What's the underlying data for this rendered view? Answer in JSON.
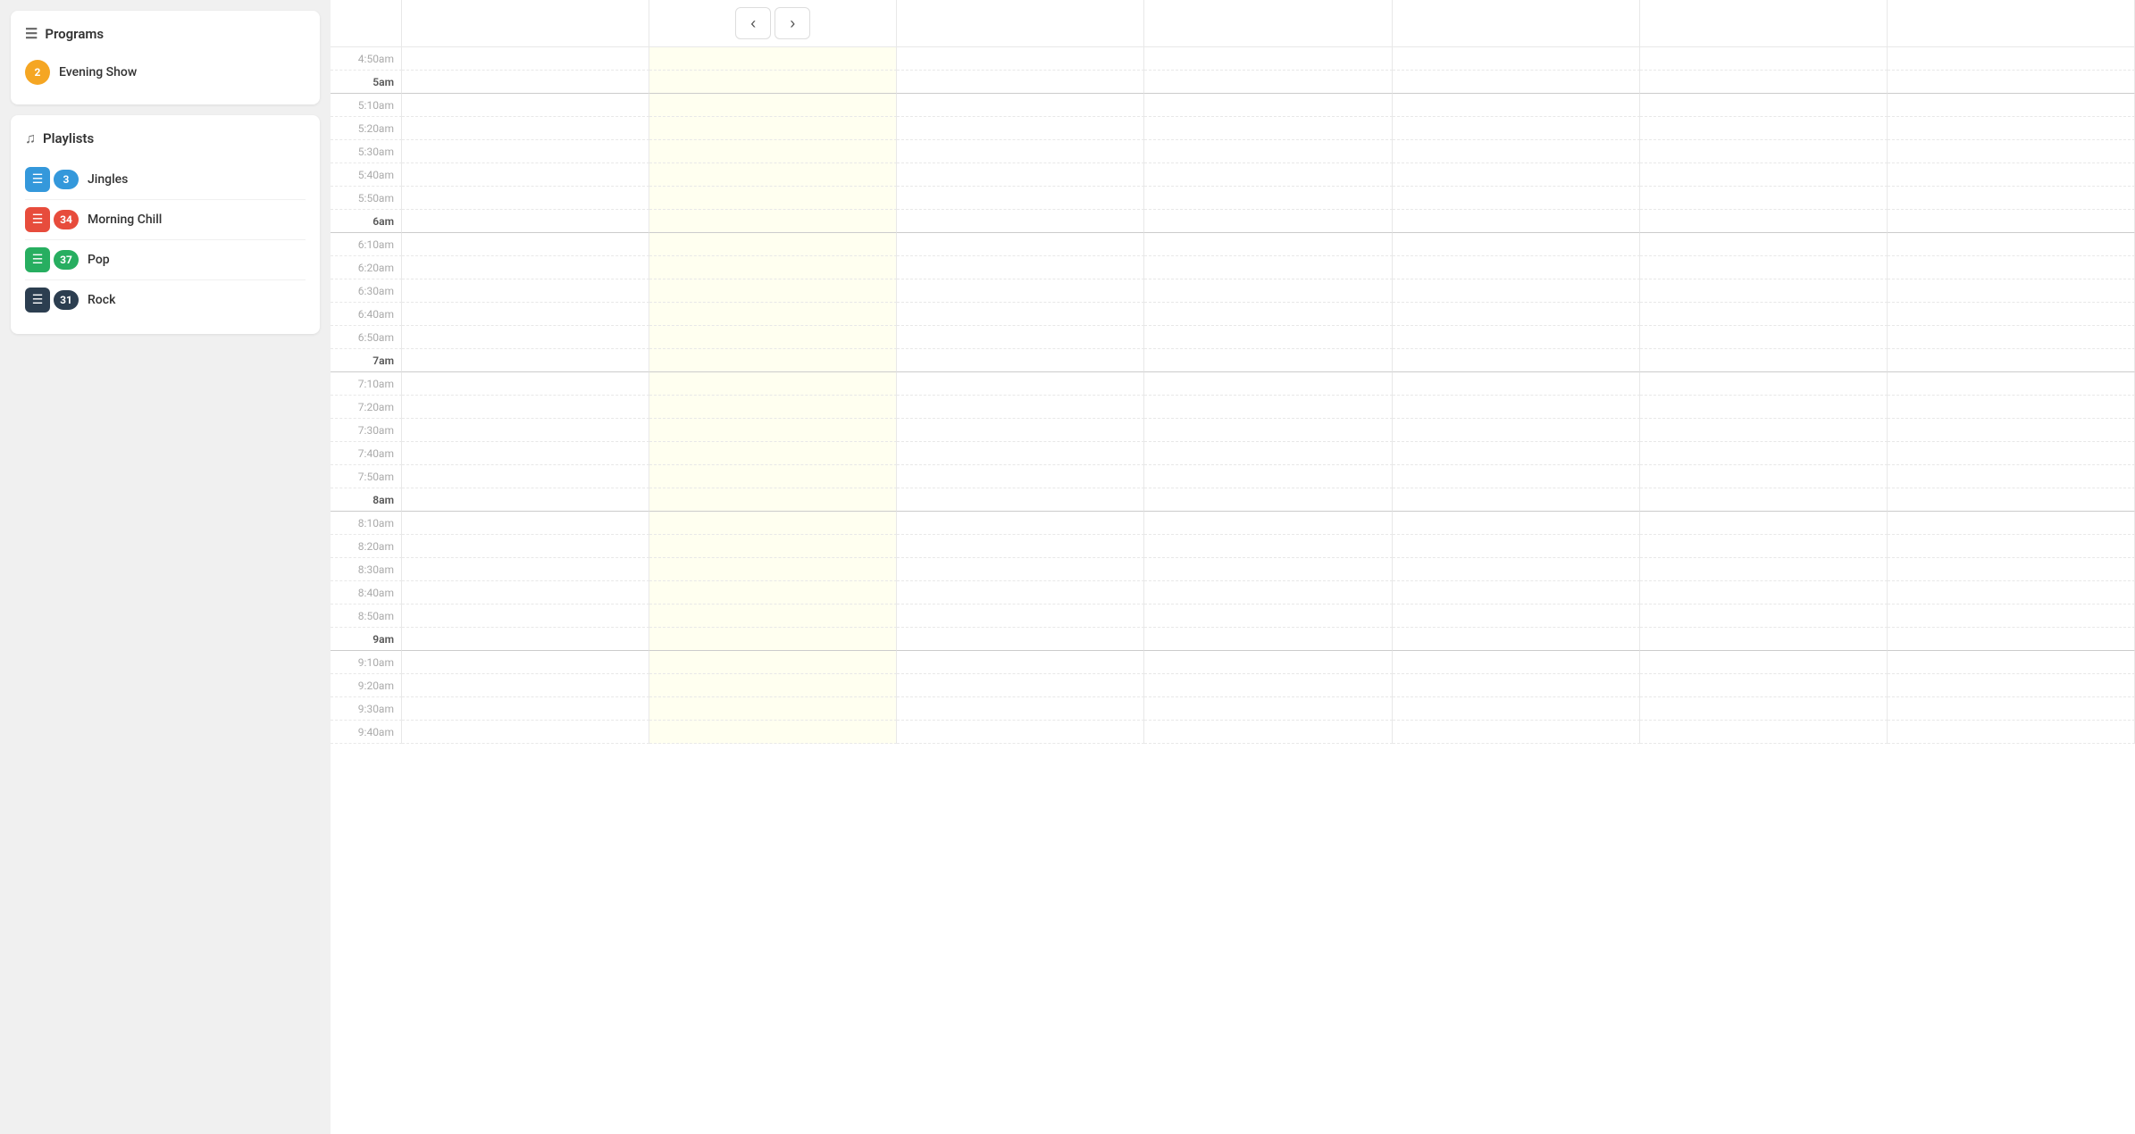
{
  "sidebar": {
    "programs_section": {
      "title": "Programs",
      "icon": "list-icon",
      "items": [
        {
          "label": "Evening Show",
          "badge": "2",
          "badge_color": "badge-yellow"
        }
      ]
    },
    "playlists_section": {
      "title": "Playlists",
      "icon": "music-icon",
      "items": [
        {
          "label": "Jingles",
          "count": "3",
          "icon_color": "icon-blue",
          "count_color": "count-blue"
        },
        {
          "label": "Morning Chill",
          "count": "34",
          "icon_color": "icon-red",
          "count_color": "count-red"
        },
        {
          "label": "Pop",
          "count": "37",
          "icon_color": "icon-green",
          "count_color": "count-green"
        },
        {
          "label": "Rock",
          "count": "31",
          "icon_color": "icon-dark",
          "count_color": "count-dark"
        }
      ]
    }
  },
  "schedule": {
    "nav": {
      "prev_label": "‹",
      "next_label": "›"
    },
    "highlighted_col": 1,
    "time_slots": [
      "4:50am",
      "5am",
      "5:10am",
      "5:20am",
      "5:30am",
      "5:40am",
      "5:50am",
      "6am",
      "6:10am",
      "6:20am",
      "6:30am",
      "6:40am",
      "6:50am",
      "7am",
      "7:10am",
      "7:20am",
      "7:30am",
      "7:40am",
      "7:50am",
      "8am",
      "8:10am",
      "8:20am",
      "8:30am",
      "8:40am",
      "8:50am",
      "9am",
      "9:10am",
      "9:20am",
      "9:30am",
      "9:40am"
    ],
    "hour_marks": [
      "5am",
      "6am",
      "7am",
      "8am",
      "9am"
    ],
    "columns": 7
  }
}
